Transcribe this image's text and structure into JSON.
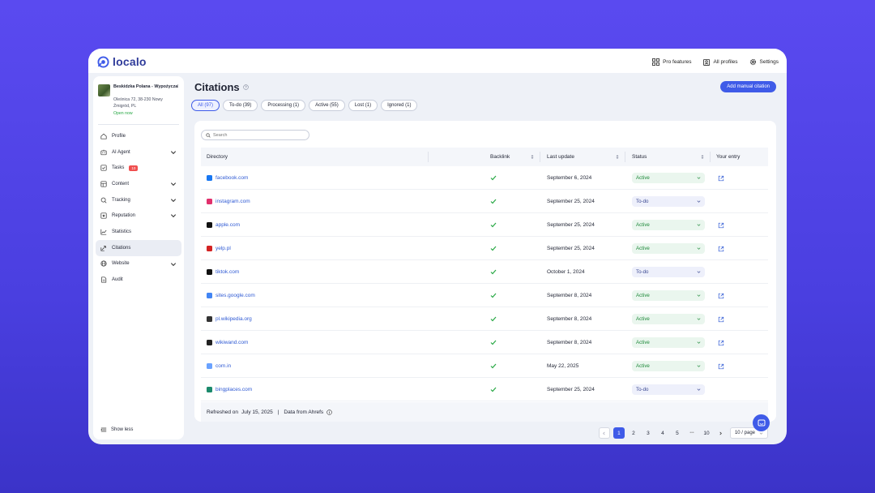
{
  "brand": {
    "name": "localo",
    "accent": "#3f5be8"
  },
  "topbar": {
    "actions": [
      {
        "label": "Pro features",
        "icon": "grid-icon"
      },
      {
        "label": "All profiles",
        "icon": "profiles-icon"
      },
      {
        "label": "Settings",
        "icon": "gear-icon"
      }
    ]
  },
  "business": {
    "name": "Beskidzka Polana - Wypożyczalnia Rowerów...",
    "address": "Oleśnica 72, 38-230 Nowy Żmigród, PL",
    "status": "Open now"
  },
  "sidebar": {
    "items": [
      {
        "label": "Profile",
        "icon": "home-icon",
        "chevron": false
      },
      {
        "label": "AI Agent",
        "icon": "robot-icon",
        "chevron": true
      },
      {
        "label": "Tasks",
        "icon": "checkbox-icon",
        "chevron": false,
        "badge": "10"
      },
      {
        "label": "Content",
        "icon": "content-icon",
        "chevron": true
      },
      {
        "label": "Tracking",
        "icon": "tracking-icon",
        "chevron": true
      },
      {
        "label": "Reputation",
        "icon": "reputation-icon",
        "chevron": true
      },
      {
        "label": "Statistics",
        "icon": "chart-icon",
        "chevron": false
      },
      {
        "label": "Citations",
        "icon": "citations-icon",
        "chevron": false,
        "active": true
      },
      {
        "label": "Website",
        "icon": "globe-icon",
        "chevron": true
      },
      {
        "label": "Audit",
        "icon": "document-icon",
        "chevron": false
      }
    ],
    "show_less": "Show less"
  },
  "main": {
    "title": "Citations",
    "add_button": "Add manual citation",
    "filters": [
      {
        "label": "All (97)",
        "active": true
      },
      {
        "label": "To-do (39)"
      },
      {
        "label": "Processing (1)"
      },
      {
        "label": "Active (55)"
      },
      {
        "label": "Lost (1)"
      },
      {
        "label": "Ignored (1)"
      }
    ],
    "search_placeholder": "Search",
    "columns": {
      "directory": "Directory",
      "backlink": "Backlink",
      "last_update": "Last update",
      "status": "Status",
      "entry": "Your entry"
    },
    "rows": [
      {
        "directory": "facebook.com",
        "favicon_color": "#1877f2",
        "date": "September 6, 2024",
        "status": "Active",
        "has_entry": true
      },
      {
        "directory": "instagram.com",
        "favicon_color": "#e1306c",
        "date": "September 25, 2024",
        "status": "To-do",
        "has_entry": false
      },
      {
        "directory": "apple.com",
        "favicon_color": "#111111",
        "date": "September 25, 2024",
        "status": "Active",
        "has_entry": true
      },
      {
        "directory": "yelp.pl",
        "favicon_color": "#d32323",
        "date": "September 25, 2024",
        "status": "Active",
        "has_entry": true
      },
      {
        "directory": "tiktok.com",
        "favicon_color": "#111111",
        "date": "October 1, 2024",
        "status": "To-do",
        "has_entry": false
      },
      {
        "directory": "sites.google.com",
        "favicon_color": "#4285f4",
        "date": "September 8, 2024",
        "status": "Active",
        "has_entry": true
      },
      {
        "directory": "pl.wikipedia.org",
        "favicon_color": "#333333",
        "date": "September 8, 2024",
        "status": "Active",
        "has_entry": true
      },
      {
        "directory": "wikiwand.com",
        "favicon_color": "#222222",
        "date": "September 8, 2024",
        "status": "Active",
        "has_entry": true
      },
      {
        "directory": "com.in",
        "favicon_color": "#6aa2ff",
        "date": "May 22, 2025",
        "status": "Active",
        "has_entry": true
      },
      {
        "directory": "bingplaces.com",
        "favicon_color": "#1c8a6c",
        "date": "September 25, 2024",
        "status": "To-do",
        "has_entry": false
      }
    ],
    "refreshed_label": "Refreshed on",
    "refreshed_date": "July 15, 2025",
    "separator": "|",
    "data_source": "Data from Ahrefs"
  },
  "pagination": {
    "pages": [
      "1",
      "2",
      "3",
      "4",
      "5"
    ],
    "ellipsis": "•••",
    "last_page": "10",
    "current": "1",
    "page_size": "10 / page"
  },
  "colors": {
    "background": "#4a3fe0",
    "status_active": "#1f8a3b",
    "status_todo": "#3c4a92",
    "link": "#2f5ad4"
  }
}
